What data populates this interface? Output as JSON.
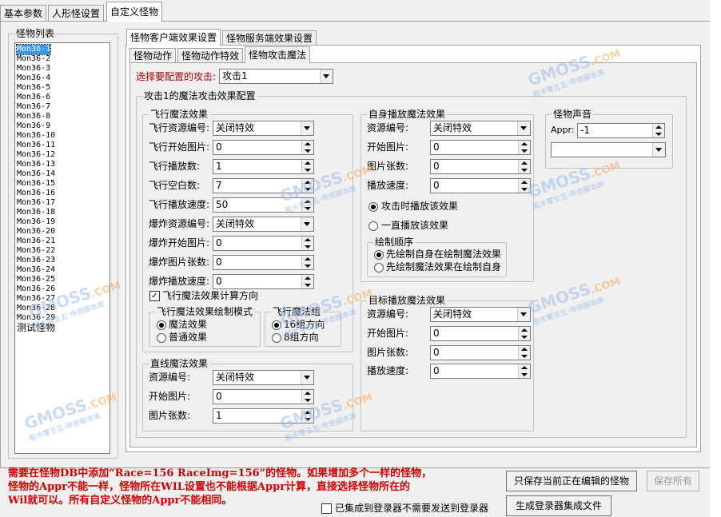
{
  "top_tabs": [
    "基本参数",
    "人形怪设置",
    "自定义怪物"
  ],
  "monster_list": {
    "label": "怪物列表",
    "items": [
      "Mon36-1",
      "Mon36-2",
      "Mon36-3",
      "Mon36-4",
      "Mon36-5",
      "Mon36-6",
      "Mon36-7",
      "Mon36-8",
      "Mon36-9",
      "Mon36-10",
      "Mon36-11",
      "Mon36-12",
      "Mon36-13",
      "Mon36-14",
      "Mon36-15",
      "Mon36-16",
      "Mon36-17",
      "Mon36-18",
      "Mon36-19",
      "Mon36-20",
      "Mon36-21",
      "Mon36-22",
      "Mon36-23",
      "Mon36-24",
      "Mon36-25",
      "Mon36-26",
      "Mon36-27",
      "Mon36-28",
      "Mon36-29",
      "测试怪物"
    ],
    "selected": "Mon36-1"
  },
  "effect_tabs": [
    "怪物客户端效果设置",
    "怪物服务端效果设置"
  ],
  "sub_tabs": [
    "怪物动作",
    "怪物动作特效",
    "怪物攻击魔法"
  ],
  "attack_select": {
    "label": "选择要配置的攻击:",
    "value": "攻击1"
  },
  "attack_group_title": "攻击1的魔法攻击效果配置",
  "fly": {
    "title": "飞行魔法效果",
    "resource_label": "飞行资源编号:",
    "resource_value": "关闭特效",
    "start_label": "飞行开始图片:",
    "start_value": "0",
    "count_label": "飞行播放数:",
    "count_value": "1",
    "blank_label": "飞行空白数:",
    "blank_value": "7",
    "speed_label": "飞行播放速度:",
    "speed_value": "50",
    "explode_resource_label": "爆炸资源编号:",
    "explode_resource_value": "关闭特效",
    "explode_start_label": "爆炸开始图片:",
    "explode_start_value": "0",
    "explode_count_label": "爆炸图片张数:",
    "explode_count_value": "0",
    "explode_speed_label": "爆炸播放速度:",
    "explode_speed_value": "0",
    "calc_direction_label": "飞行魔法效果计算方向",
    "draw_mode": {
      "title": "飞行魔法效果绘制模式",
      "options": [
        "魔法效果",
        "普通效果"
      ]
    },
    "group": {
      "title": "飞行魔法组",
      "options": [
        "16组方向",
        "8组方向"
      ]
    }
  },
  "line": {
    "title": "直线魔法效果",
    "resource_label": "资源编号:",
    "resource_value": "关闭特效",
    "start_label": "开始图片:",
    "start_value": "0",
    "count_label": "图片张数:",
    "count_value": "1"
  },
  "self": {
    "title": "自身播放魔法效果",
    "resource_label": "资源编号:",
    "resource_value": "关闭特效",
    "start_label": "开始图片:",
    "start_value": "0",
    "count_label": "图片张数:",
    "count_value": "0",
    "speed_label": "播放速度:",
    "speed_value": "0",
    "play_options": [
      "攻击时播放该效果",
      "一直播放该效果"
    ],
    "draw_order": {
      "title": "绘制顺序",
      "options": [
        "先绘制自身在绘制魔法效果",
        "先绘制魔法效果在绘制自身"
      ]
    }
  },
  "target": {
    "title": "目标播放魔法效果",
    "resource_label": "资源编号:",
    "resource_value": "关闭特效",
    "start_label": "开始图片:",
    "start_value": "0",
    "count_label": "图片张数:",
    "count_value": "0",
    "speed_label": "播放速度:",
    "speed_value": "0"
  },
  "sound": {
    "title": "怪物声音",
    "appr_label": "Appr:",
    "appr_value": "-1",
    "select_value": ""
  },
  "note_lines": [
    "需要在怪物DB中添加“Race=156 RaceImg=156”的怪物。如果增加多个一样的怪物，",
    "怪物的Appr不能一样，怪物所在WIL设置也不能根据Appr计算，直接选择怪物所在的",
    "Wil就可以。所有自定义怪物的Appr不能相同。"
  ],
  "buttons": {
    "save_current": "只保存当前正在编辑的怪物",
    "save_all": "保存所有",
    "generate": "生成登录器集成文件"
  },
  "integrated_label": "已集成到登录器不需要发送到登录器",
  "watermark": {
    "brand": "GMOSS",
    "suffix": ".COM",
    "tagline": "般木零五五·传奇脚本库"
  }
}
